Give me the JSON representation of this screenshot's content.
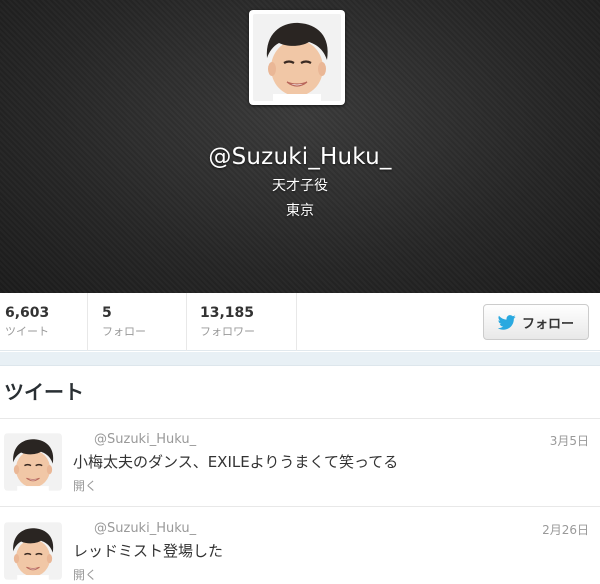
{
  "profile": {
    "screen_name": "@Suzuki_Huku_",
    "bio": "天才子役",
    "location": "東京"
  },
  "stats": {
    "tweets": {
      "value": "6,603",
      "label": "ツイート"
    },
    "following": {
      "value": "5",
      "label": "フォロー"
    },
    "followers": {
      "value": "13,185",
      "label": "フォロワー"
    }
  },
  "follow_button": {
    "label": "フォロー",
    "icon": "twitter-bird-icon"
  },
  "timeline": {
    "heading": "ツイート",
    "tweets": [
      {
        "handle": "@Suzuki_Huku_",
        "date": "3月5日",
        "text": "小梅太夫のダンス、EXILEよりうまくて笑ってる",
        "expand": "開く"
      },
      {
        "handle": "@Suzuki_Huku_",
        "date": "2月26日",
        "text": "レッドミスト登場した",
        "expand": "開く"
      }
    ]
  },
  "colors": {
    "header_bg": "#262626",
    "twitter_blue": "#2aa9e0",
    "muted_text": "#999999",
    "divider_strip": "#e8f0f5"
  }
}
